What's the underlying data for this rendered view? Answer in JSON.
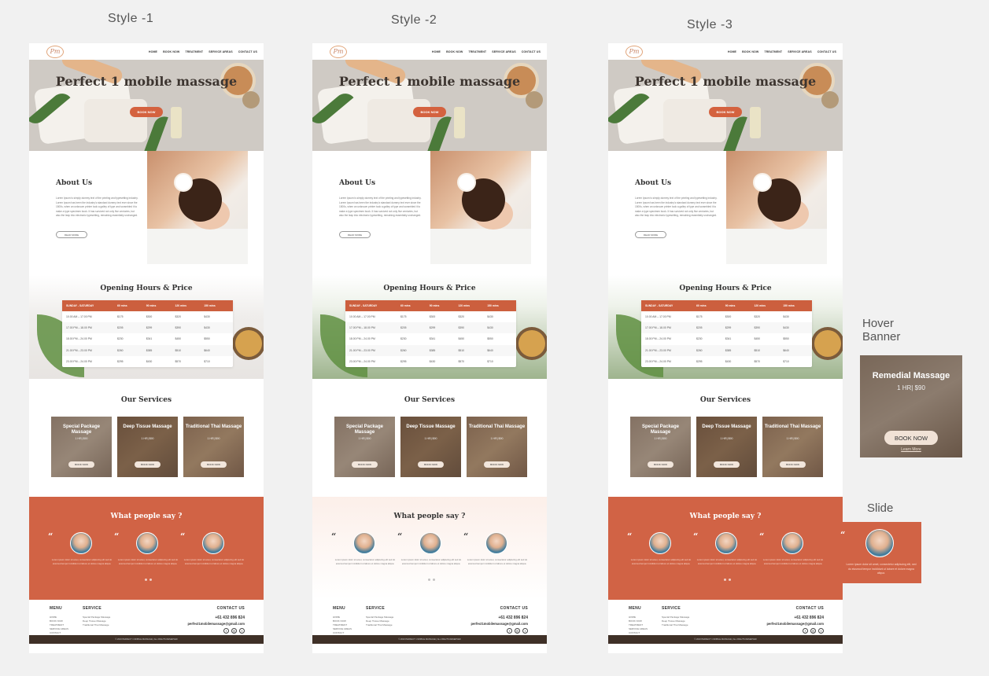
{
  "labels": {
    "style1": "Style -1",
    "style2": "Style -2",
    "style3": "Style -3",
    "hover_banner": "Hover\nBanner",
    "slide": "Slide"
  },
  "site": {
    "logo": "Pm",
    "nav": [
      "HOME",
      "BOOK NOW",
      "TREATMENT",
      "SERVICE AREAS",
      "CONTACT US"
    ],
    "hero_title": "Perfect 1 mobile massage",
    "hero_button": "BOOK NOW",
    "about_title": "About Us",
    "about_text": "Lorem Ipsum is simply dummy text of the printing and typesetting industry. Lorem Ipsum has been the industry's standard dummy text ever since the 1500s, when an unknown printer took a galley of type and scrambled it to make a type specimen book. It has survived not only five centuries, but also the leap into electronic typesetting, remaining essentially unchanged.",
    "read_more": "READ MORE",
    "hours_title": "Opening Hours & Price",
    "table": {
      "headers": [
        "SUNDAY - SATURDAY",
        "60 mins",
        "90 mins",
        "120 mins",
        "150 mins"
      ],
      "rows": [
        [
          "10.00 AM – 17.00 PM",
          "$175",
          "$300",
          "$320",
          "$430"
        ],
        [
          "17.00 PM – 18.00 PM",
          "$205",
          "$299",
          "$390",
          "$430"
        ],
        [
          "18.00 PM – 24.00 PM",
          "$230",
          "$341",
          "$450",
          "$550"
        ],
        [
          "21.00 PM – 23.00 PM",
          "$260",
          "$385",
          "$510",
          "$640"
        ],
        [
          "23.00 PM – 24.00 PM",
          "$295",
          "$430",
          "$570",
          "$710"
        ]
      ]
    },
    "services_title": "Our Services",
    "services": [
      {
        "title": "Special Package Massage",
        "price": "1 HR| $90",
        "button": "BOOK NOW"
      },
      {
        "title": "Deep Tissue Massage",
        "price": "1 HR| $90",
        "button": "BOOK NOW"
      },
      {
        "title": "Traditional Thai Massage",
        "price": "1 HR| $90",
        "button": "BOOK NOW"
      }
    ],
    "testimonials_title": "What people say ?",
    "testimonial_text": "Lorem ipsum dolor sit amet, consectetur adipiscing elit sed do eiusmod tempor incididunt ut labore et dolore magna aliqua.",
    "footer": {
      "menu_title": "MENU",
      "menu_items": [
        "HOME",
        "BOOK NOW",
        "TREATMENT",
        "SERVICE AREAS",
        "CONTACT"
      ],
      "service_title": "SERVICE",
      "service_items": [
        "Special Package Massage",
        "Deep Tissue Massage",
        "Traditional Thai Massage"
      ],
      "contact_title": "CONTACT US",
      "phone": "+61 432 896 824",
      "email": "perfect1mobilemassage@gmail.com",
      "social": [
        "f",
        "◎",
        "t"
      ],
      "copyright": "© 2023 PERFECT 1 MOBILE MASSAGE | ALL RIGHTS RESERVED"
    }
  },
  "hover_banner": {
    "title": "Remedial Massage",
    "price": "1 HR| $90",
    "button": "BOOK NOW",
    "link": "Learn More"
  },
  "slide": {
    "text": "Lorem ipsum dolor sit amet, consectetur adipiscing elit, sed do eiusmod tempor incididunt ut labore et dolore magna aliqua."
  }
}
